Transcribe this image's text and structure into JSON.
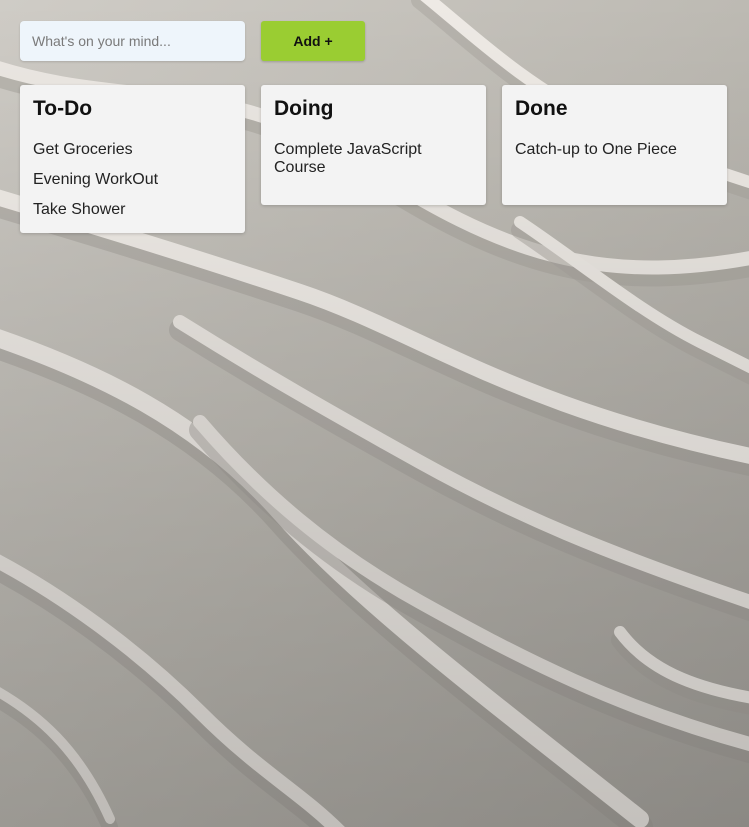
{
  "form": {
    "input_placeholder": "What's on your mind...",
    "input_value": "",
    "add_button_label": "Add +"
  },
  "columns": [
    {
      "title": "To-Do",
      "items": [
        "Get Groceries",
        "Evening WorkOut",
        "Take Shower"
      ]
    },
    {
      "title": "Doing",
      "items": [
        "Complete JavaScript Course"
      ]
    },
    {
      "title": "Done",
      "items": [
        "Catch-up to One Piece"
      ]
    }
  ],
  "colors": {
    "add_button": "#9acd32",
    "card_background": "#f3f3f3",
    "input_background": "#eef5fb"
  }
}
